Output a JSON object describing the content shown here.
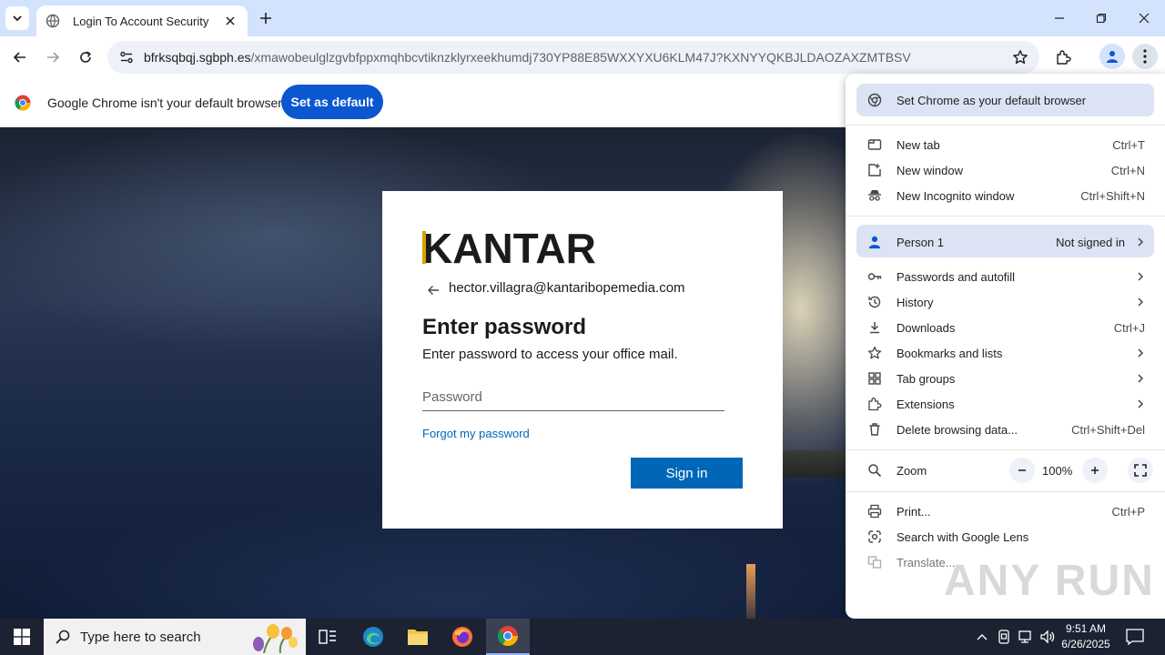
{
  "browser": {
    "tab": {
      "title": "Login To Account Security"
    },
    "address": {
      "host": "bfrksqbqj.sgbph.es",
      "path": "/xmawobeulglzgvbfppxmqhbcvtiknzklyrxeekhumdj730YP88E85WXXYXU6KLM47J?KXNYYQKBJLDAOZAXZMTBSV"
    },
    "infobar": {
      "message": "Google Chrome isn't your default browser",
      "button_label": "Set as default"
    }
  },
  "login": {
    "brand": "KANTAR",
    "email": "hector.villagra@kantaribopemedia.com",
    "title": "Enter password",
    "subtitle": "Enter password to access your office mail.",
    "password_placeholder": "Password",
    "forgot_link": "Forgot my password",
    "signin_label": "Sign in"
  },
  "menu": {
    "set_default": "Set Chrome as your default browser",
    "new_tab": {
      "label": "New tab",
      "shortcut": "Ctrl+T"
    },
    "new_window": {
      "label": "New window",
      "shortcut": "Ctrl+N"
    },
    "new_incognito": {
      "label": "New Incognito window",
      "shortcut": "Ctrl+Shift+N"
    },
    "profile": {
      "label": "Person 1",
      "status": "Not signed in"
    },
    "passwords": {
      "label": "Passwords and autofill"
    },
    "history": {
      "label": "History"
    },
    "downloads": {
      "label": "Downloads",
      "shortcut": "Ctrl+J"
    },
    "bookmarks": {
      "label": "Bookmarks and lists"
    },
    "tab_groups": {
      "label": "Tab groups"
    },
    "extensions": {
      "label": "Extensions"
    },
    "delete_data": {
      "label": "Delete browsing data...",
      "shortcut": "Ctrl+Shift+Del"
    },
    "zoom": {
      "label": "Zoom",
      "value": "100%"
    },
    "print": {
      "label": "Print...",
      "shortcut": "Ctrl+P"
    },
    "lens": {
      "label": "Search with Google Lens"
    },
    "translate": {
      "label": "Translate..."
    }
  },
  "watermark": "ANY RUN",
  "taskbar": {
    "search_placeholder": "Type here to search",
    "time": "9:51 AM",
    "date": "6/26/2025"
  },
  "colors": {
    "chrome_blue": "#0b57d0",
    "ms_blue": "#0067b8",
    "tabbar": "#d3e3fd",
    "kantar_accent": "#d8a200"
  }
}
